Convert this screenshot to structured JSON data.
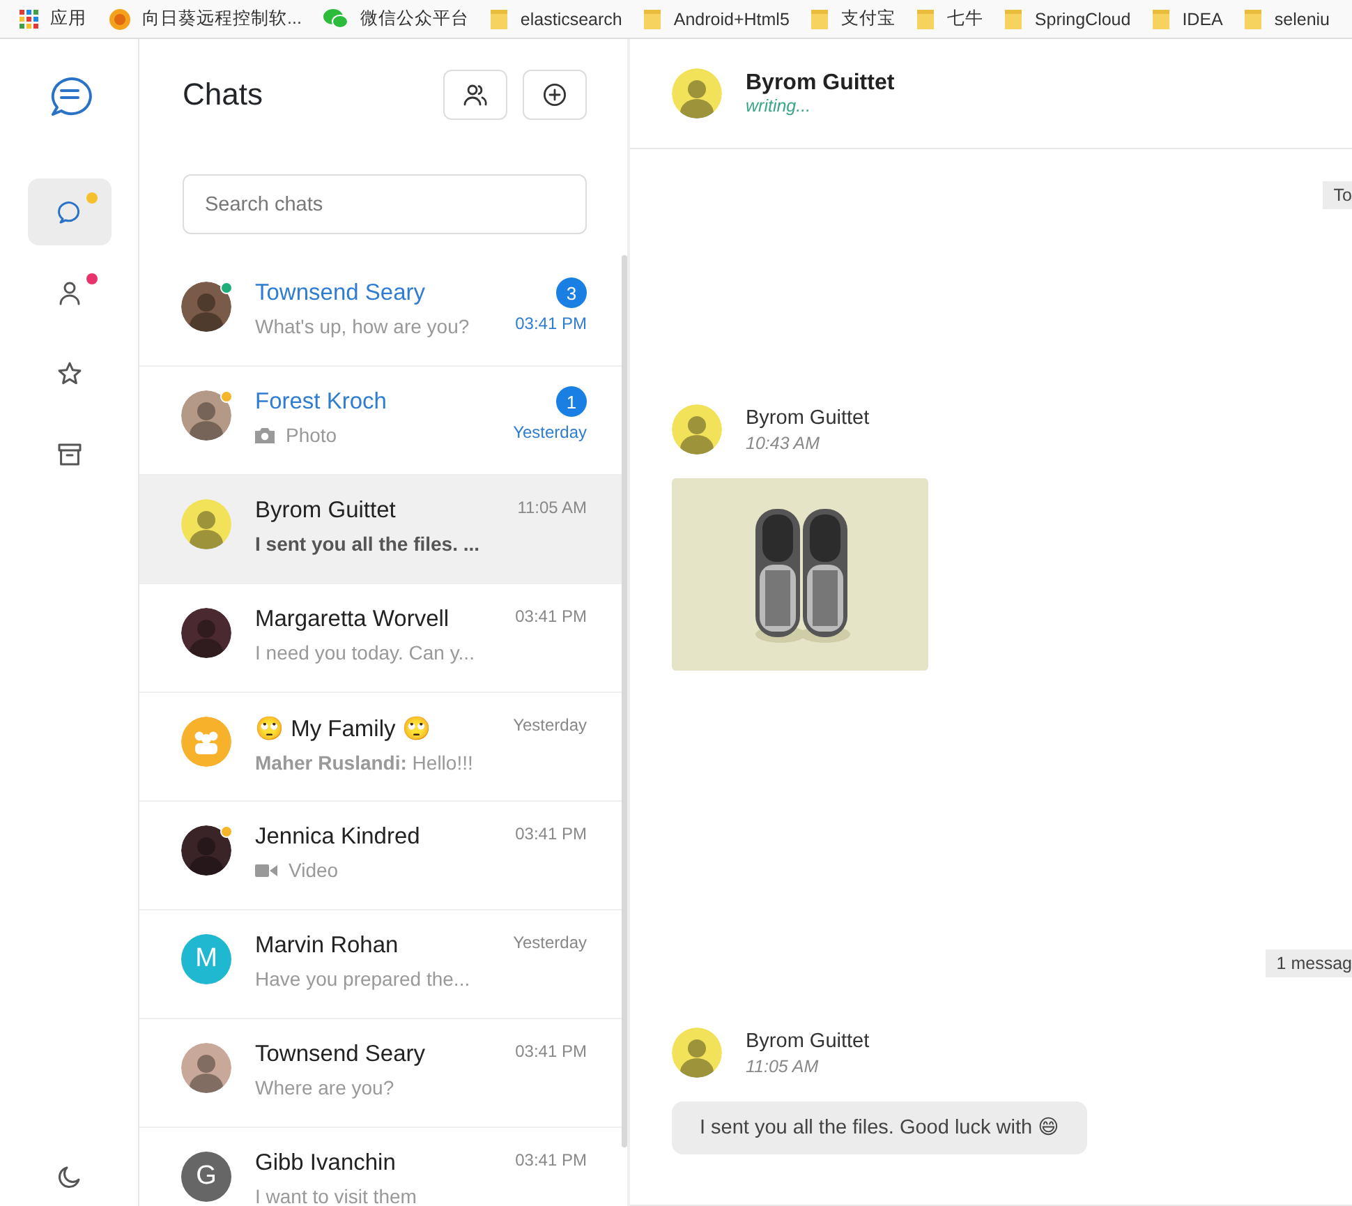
{
  "bookmarks": [
    {
      "label": "应用",
      "kind": "apps"
    },
    {
      "label": "向日葵远程控制软...",
      "kind": "sunflower"
    },
    {
      "label": "微信公众平台",
      "kind": "chat"
    },
    {
      "label": "elasticsearch",
      "kind": "folder"
    },
    {
      "label": "Android+Html5",
      "kind": "folder"
    },
    {
      "label": "支付宝",
      "kind": "folder"
    },
    {
      "label": "七牛",
      "kind": "folder"
    },
    {
      "label": "SpringCloud",
      "kind": "folder"
    },
    {
      "label": "IDEA",
      "kind": "folder"
    },
    {
      "label": "seleniu",
      "kind": "folder"
    }
  ],
  "nav": {
    "items": [
      {
        "kind": "chat",
        "selected": true,
        "badge": {
          "color": "#f5c02b"
        }
      },
      {
        "kind": "person",
        "selected": false,
        "badge": {
          "color": "#e8336a"
        }
      },
      {
        "kind": "star",
        "selected": false
      },
      {
        "kind": "archive",
        "selected": false
      }
    ],
    "theme_toggle": {
      "kind": "moon"
    }
  },
  "chats": {
    "title": "Chats",
    "buttons": [
      {
        "kind": "group"
      },
      {
        "kind": "add"
      }
    ],
    "search": {
      "placeholder": "Search chats"
    },
    "items": [
      {
        "name": "Townsend Seary",
        "preview": "What's up, how are you?",
        "kind": "text",
        "preview_bold": false,
        "time": "03:41 PM",
        "unread": "3",
        "selected": false,
        "status": {
          "color": "#1fae7a"
        }
      },
      {
        "name": "Forest Kroch",
        "preview": "Photo",
        "preview_bold": false,
        "time": "Yesterday",
        "unread": "1",
        "selected": false,
        "status": {
          "color": "#f5b52b"
        }
      },
      {
        "name": "Byrom Guittet",
        "preview": "I sent you all the files. ...",
        "kind": "text",
        "preview_bold": true,
        "time": "11:05 AM",
        "selected": true
      },
      {
        "name": "Margaretta Worvell",
        "preview": "I need you today. Can y...",
        "kind": "text",
        "preview_bold": false,
        "time": "03:41 PM",
        "selected": false
      },
      {
        "name": "🙄 My Family 🙄",
        "preview": "**Maher Ruslandi:** Hello!!!",
        "kind": "text",
        "preview_bold": false,
        "time": "Yesterday",
        "selected": false,
        "avatar": {
          "kind": "group",
          "color": "#f7b12a"
        }
      },
      {
        "name": "Jennica Kindred",
        "preview": "Video",
        "kind": "video",
        "preview_bold": false,
        "time": "03:41 PM",
        "selected": false,
        "status": {
          "color": "#f5b52b"
        }
      },
      {
        "name": "Marvin Rohan",
        "preview": "Have you prepared the...",
        "kind": "text",
        "preview_bold": false,
        "time": "Yesterday",
        "selected": false,
        "avatar": {
          "kind": "letter",
          "letter": "M",
          "color": "#1fb8d0"
        }
      },
      {
        "name": "Townsend Seary",
        "preview": "Where are you?",
        "kind": "text",
        "preview_bold": false,
        "time": "03:41 PM",
        "selected": false
      },
      {
        "name": "Gibb Ivanchin",
        "preview": "I want to visit them",
        "kind": "text",
        "preview_bold": false,
        "time": "03:41 PM",
        "selected": false,
        "avatar": {
          "kind": "letter",
          "letter": "G",
          "color": "#666666"
        }
      }
    ]
  },
  "conversation": {
    "contact": {
      "name": "Byrom Guittet",
      "status": "writing..."
    },
    "messages": [
      {
        "kind": "divider",
        "label": "To"
      },
      {
        "sender": "Byrom Guittet",
        "time": "10:43 AM"
      },
      {
        "kind": "divider",
        "label": "1 messag"
      },
      {
        "kind": "text",
        "sender": "Byrom Guittet",
        "time": "11:05 AM",
        "text": "I sent you all the files. Good luck with 😄"
      }
    ]
  }
}
